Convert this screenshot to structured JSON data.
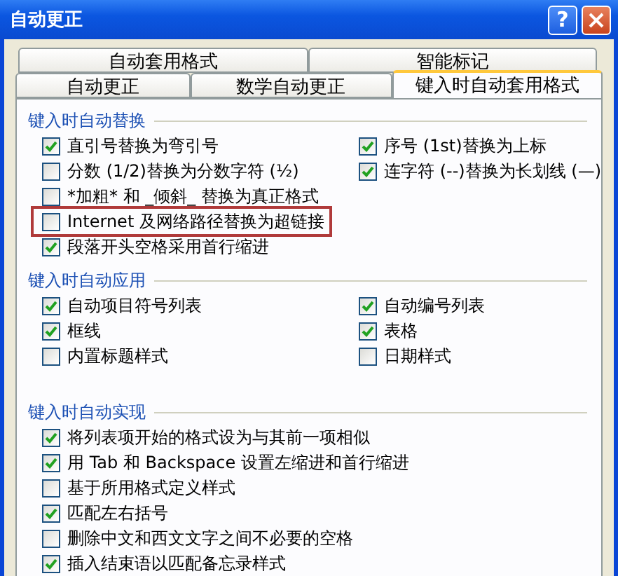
{
  "window": {
    "title": "自动更正",
    "help_button": "?"
  },
  "tab_rows": [
    [
      {
        "label": "自动套用格式",
        "selected": false
      },
      {
        "label": "智能标记",
        "selected": false
      }
    ],
    [
      {
        "label": "自动更正",
        "selected": false
      },
      {
        "label": "数学自动更正",
        "selected": false
      },
      {
        "label": "键入时自动套用格式",
        "selected": true
      }
    ]
  ],
  "sections": [
    {
      "title": "键入时自动替换",
      "left": [
        {
          "label": "直引号替换为弯引号",
          "checked": true,
          "highlighted": false
        },
        {
          "label": "分数 (1/2)替换为分数字符 (½)",
          "checked": false,
          "highlighted": false
        },
        {
          "label": "*加粗* 和 _倾斜_ 替换为真正格式",
          "checked": false,
          "highlighted": false
        },
        {
          "label": "Internet 及网络路径替换为超链接",
          "checked": false,
          "highlighted": true
        },
        {
          "label": "段落开头空格采用首行缩进",
          "checked": true,
          "highlighted": false
        }
      ],
      "right": [
        {
          "label": "序号 (1st)替换为上标",
          "checked": true,
          "highlighted": false
        },
        {
          "label": "连字符 (--)替换为长划线 (—)",
          "checked": true,
          "highlighted": false
        }
      ]
    },
    {
      "title": "键入时自动应用",
      "left": [
        {
          "label": "自动项目符号列表",
          "checked": true,
          "highlighted": false
        },
        {
          "label": "框线",
          "checked": true,
          "highlighted": false
        },
        {
          "label": "内置标题样式",
          "checked": false,
          "highlighted": false
        }
      ],
      "right": [
        {
          "label": "自动编号列表",
          "checked": true,
          "highlighted": false
        },
        {
          "label": "表格",
          "checked": true,
          "highlighted": false
        },
        {
          "label": "日期样式",
          "checked": false,
          "highlighted": false
        }
      ]
    },
    {
      "title": "键入时自动实现",
      "left": [
        {
          "label": "将列表项开始的格式设为与其前一项相似",
          "checked": true,
          "highlighted": false
        },
        {
          "label": "用 Tab 和 Backspace 设置左缩进和首行缩进",
          "checked": true,
          "highlighted": false
        },
        {
          "label": "基于所用格式定义样式",
          "checked": false,
          "highlighted": false
        },
        {
          "label": "匹配左右括号",
          "checked": true,
          "highlighted": false
        },
        {
          "label": "删除中文和西文文字之间不必要的空格",
          "checked": false,
          "highlighted": false
        },
        {
          "label": "插入结束语以匹配备忘录样式",
          "checked": true,
          "highlighted": false
        }
      ]
    }
  ]
}
